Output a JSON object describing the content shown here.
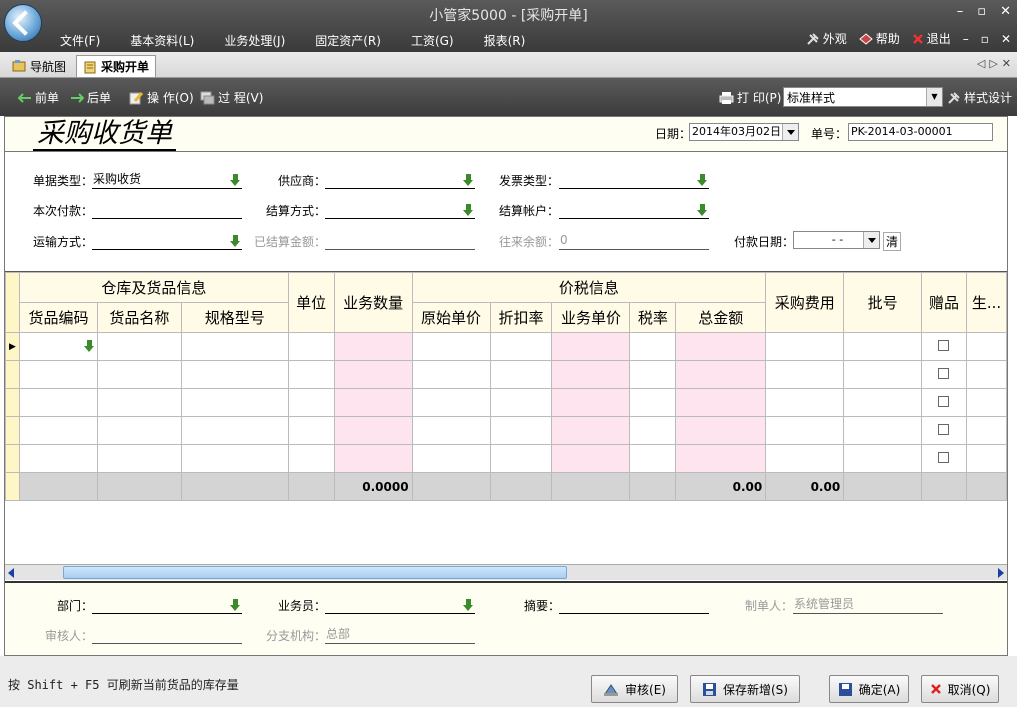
{
  "window": {
    "title": "小管家5000 - [采购开单]",
    "controls": [
      "–",
      "▫",
      "✕"
    ]
  },
  "menu": {
    "items": [
      "文件(F)",
      "基本资料(L)",
      "业务处理(J)",
      "固定资产(R)",
      "工资(G)",
      "报表(R)"
    ],
    "right": {
      "appearance": "外观",
      "help": "帮助",
      "exit": "退出",
      "mdi_controls": [
        "–",
        "▫",
        "✕"
      ]
    }
  },
  "tabs": [
    {
      "label": "导航图"
    },
    {
      "label": "采购开单"
    }
  ],
  "tab_nav": [
    "◁",
    "▷",
    "✕"
  ],
  "toolbar": {
    "prev": "前单",
    "next": "后单",
    "operate": "操 作(O)",
    "process": "过 程(V)",
    "print": "打 印(P)",
    "style_value": "标准样式",
    "style_design": "样式设计"
  },
  "form": {
    "title": "采购收货单",
    "date_label": "日期：",
    "date_value": "2014年03月02日",
    "number_label": "单号：",
    "number_value": "PK-2014-03-00001",
    "fields": {
      "doc_type_label": "单据类型：",
      "doc_type_value": "采购收货",
      "supplier_label": "供应商：",
      "invoice_type_label": "发票类型：",
      "payment_label": "本次付款：",
      "settle_method_label": "结算方式：",
      "settle_account_label": "结算帐户：",
      "transport_label": "运输方式：",
      "settled_amount_label": "已结算金额：",
      "balance_label": "往来余额：",
      "balance_value": "0",
      "pay_date_label": "付款日期：",
      "pay_date_value": "-   -",
      "clear_label": "清"
    }
  },
  "grid": {
    "group_headers": {
      "warehouse": "仓库及货品信息",
      "unit": "单位",
      "qty": "业务数量",
      "price_tax": "价税信息",
      "purchase_fee": "采购费用",
      "batch": "批号",
      "gift": "赠品",
      "prod": "生..."
    },
    "sub_headers": {
      "code": "货品编码",
      "name": "货品名称",
      "spec": "规格型号",
      "orig_price": "原始单价",
      "discount": "折扣率",
      "biz_price": "业务单价",
      "tax_rate": "税率",
      "total": "总金额"
    },
    "totals": {
      "qty": "0.0000",
      "total": "0.00",
      "purchase_fee": "0.00"
    }
  },
  "footer": {
    "department_label": "部门：",
    "salesperson_label": "业务员：",
    "summary_label": "摘要：",
    "creator_label": "制单人：",
    "creator_value": "系统管理员",
    "auditor_label": "审核人：",
    "branch_label": "分支机构：",
    "branch_value": "总部"
  },
  "status": {
    "hint": "按 Shift + F5 可刷新当前货品的库存量"
  },
  "buttons": {
    "audit": "审核(E)",
    "save_new": "保存新增(S)",
    "confirm": "确定(A)",
    "cancel": "取消(Q)"
  },
  "colors": {
    "title_bar": "#4a4a4a",
    "pink_column": "#fde4ef",
    "indicator_column": "#fff6c8",
    "form_bg": "#fffef3",
    "green_arrow": "#3b8a2b"
  },
  "icons": [
    "app-logo-icon",
    "appearance-icon",
    "help-book-icon",
    "exit-x-icon",
    "nav-map-icon",
    "purchase-doc-icon",
    "prev-arrow-icon",
    "next-arrow-icon",
    "operate-icon",
    "process-icon",
    "printer-icon",
    "style-design-icon",
    "dropdown-down-arrow-icon",
    "audit-icon",
    "save-disk-icon",
    "confirm-disk-icon",
    "cancel-x-icon"
  ]
}
